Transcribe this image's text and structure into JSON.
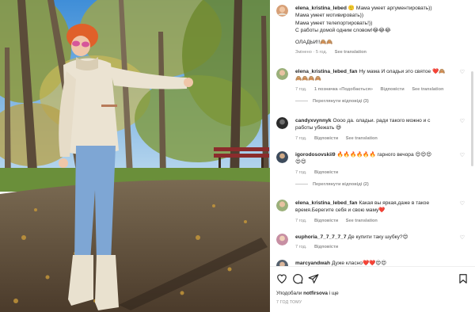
{
  "photo": {
    "alt_name": "post-photo"
  },
  "comments": [
    {
      "user": "elena_kristina_lebed",
      "lines": [
        "🙂 Мама умеет аргументировать))",
        "Мама умеет мотивировать))",
        "Мама умеет телепортировать!))",
        "С работы домой одним словом!😂😂😂",
        "",
        "ОЛАДЬИ!!🙈🙈"
      ],
      "meta": [
        "Змінено · 5 год.",
        "See translation"
      ]
    },
    {
      "user": "elena_kristina_lebed_fan",
      "lines": [
        "Ну мама И оладьи это святое ❤️🙈",
        "🙈🙈🙈🙈"
      ],
      "meta": [
        "7 год.",
        "1 позначка «Подобається»",
        "Відповісти",
        "See translation"
      ],
      "replies": "Переглянути відповіді (3)"
    },
    {
      "user": "candyxvynnyk",
      "lines": [
        "Оооо да. оладьи. ради такого можно и с",
        "работы убежать 😅"
      ],
      "meta": [
        "7 год.",
        "Відповісти",
        "See translation"
      ]
    },
    {
      "user": "igorodosovskii9",
      "lines": [
        "🔥🔥🔥🔥🔥🔥 гарного вечора 😍😍😍",
        "😍😍"
      ],
      "meta": [
        "7 год.",
        "Відповісти"
      ],
      "replies": "Переглянути відповіді (2)"
    },
    {
      "user": "elena_kristina_lebed_fan",
      "lines": [
        "Какая вы яркая,даже в такое",
        "время.Берегите себя и свою маму❤️"
      ],
      "meta": [
        "7 год.",
        "Відповісти",
        "See translation"
      ]
    },
    {
      "user": "euphoria_7_7_7_7_7",
      "lines": [
        "Де купити таку шубку?😍"
      ],
      "meta": [
        "7 год.",
        "Відповісти"
      ]
    },
    {
      "user": "marcyandwah",
      "lines": [
        "Дуже класно❤️❤️😍😍"
      ],
      "meta": []
    }
  ],
  "actions": {
    "likes_prefix": "Уподобали",
    "likes_user": "notfirsova",
    "likes_suffix": "і ще",
    "time": "7 ГОД ТОМУ"
  },
  "colors": {
    "text": "#262626",
    "secondary": "#8e8e8e",
    "like_red": "#ed4956",
    "sky": "#5aa9e6",
    "grass": "#6a8f3a"
  }
}
